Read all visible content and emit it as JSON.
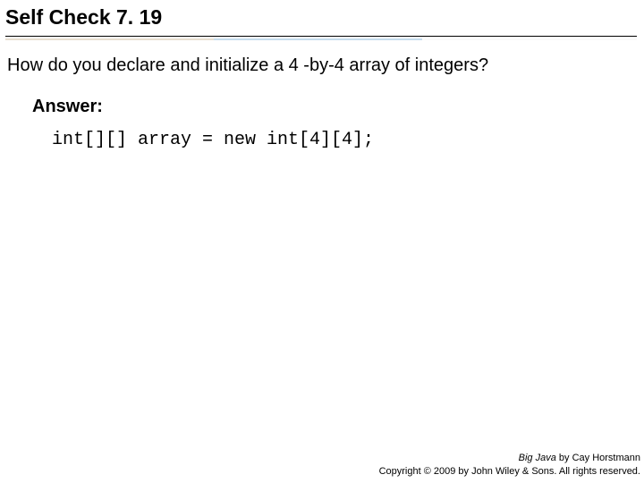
{
  "title": "Self Check 7. 19",
  "question": "How do you declare and initialize a 4 -by-4 array of integers?",
  "answer_label": "Answer:",
  "code": "int[][] array = new int[4][4];",
  "footer": {
    "book_title": "Big Java",
    "author_line": " by Cay Horstmann",
    "copyright": "Copyright © 2009 by John Wiley & Sons. All rights reserved."
  }
}
